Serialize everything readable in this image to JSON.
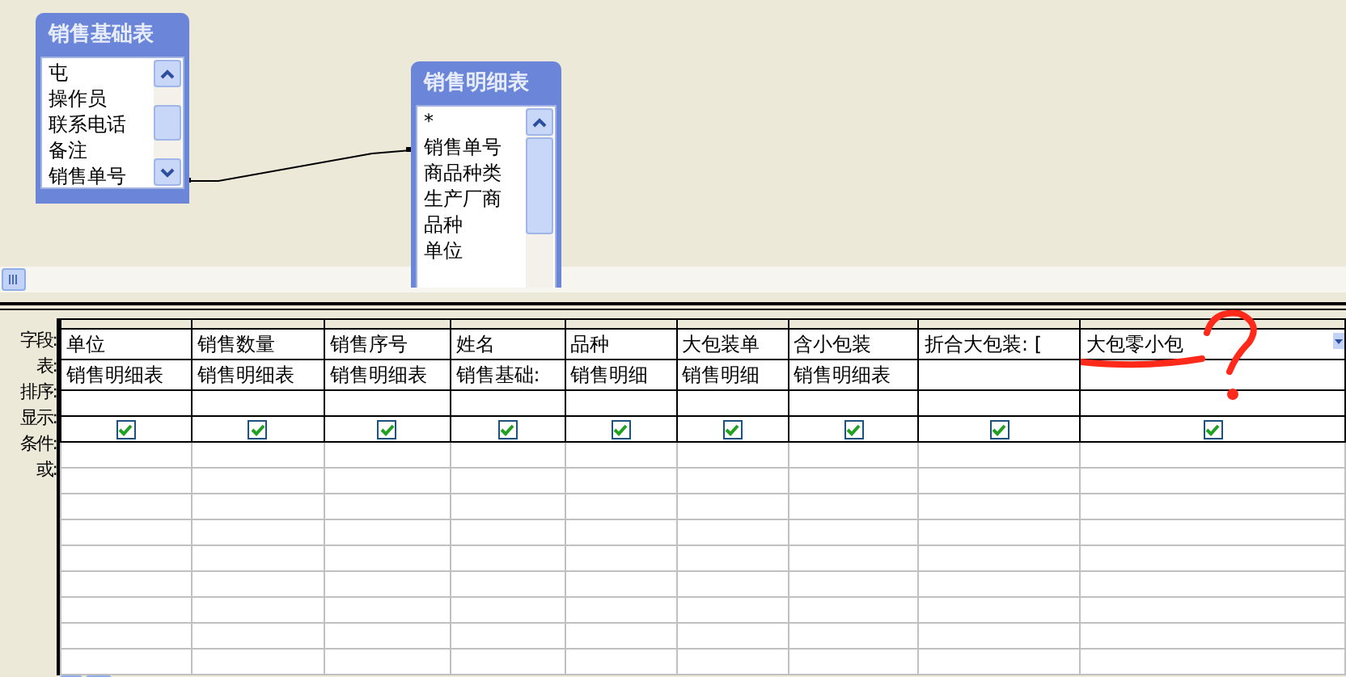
{
  "tables": [
    {
      "title": "销售基础表",
      "fields": [
        "屯",
        "操作员",
        "联系电话",
        "备注",
        "销售单号"
      ]
    },
    {
      "title": "销售明细表",
      "fields": [
        "*",
        "销售单号",
        "商品种类",
        "生产厂商",
        "品种",
        "单位"
      ]
    }
  ],
  "grid": {
    "row_labels": [
      "字段:",
      "表:",
      "排序:",
      "显示:",
      "条件:",
      "或:"
    ],
    "columns": [
      {
        "field": "单位",
        "table": "销售明细表",
        "show": true,
        "active": false
      },
      {
        "field": "销售数量",
        "table": "销售明细表",
        "show": true,
        "active": false
      },
      {
        "field": "销售序号",
        "table": "销售明细表",
        "show": true,
        "active": false
      },
      {
        "field": "姓名",
        "table": "销售基础:",
        "show": true,
        "active": false
      },
      {
        "field": "品种",
        "table": "销售明细",
        "show": true,
        "active": false
      },
      {
        "field": "大包装单",
        "table": "销售明细",
        "show": true,
        "active": false
      },
      {
        "field": "含小包装",
        "table": "销售明细表",
        "show": true,
        "active": false
      },
      {
        "field": "折合大包装: [",
        "show": true,
        "active": false
      },
      {
        "field": "大包零小包",
        "show": true,
        "active": true
      }
    ]
  }
}
